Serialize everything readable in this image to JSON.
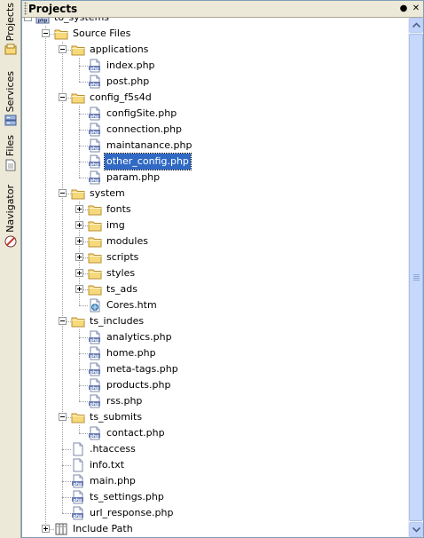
{
  "side_tabs": [
    {
      "label": "Projects",
      "icon": "projects-icon"
    },
    {
      "label": "Services",
      "icon": "services-icon"
    },
    {
      "label": "Files",
      "icon": "files-icon"
    },
    {
      "label": "Navigator",
      "icon": "navigator-icon"
    }
  ],
  "panel": {
    "title": "Projects",
    "pin_label": "●",
    "close_label": "✕"
  },
  "tree": [
    {
      "label": "to_systems",
      "depth": 0,
      "type": "project",
      "toggle": "minus"
    },
    {
      "label": "Source Files",
      "depth": 1,
      "type": "folder",
      "toggle": "minus"
    },
    {
      "label": "applications",
      "depth": 2,
      "type": "folder",
      "toggle": "minus"
    },
    {
      "label": "index.php",
      "depth": 3,
      "type": "php"
    },
    {
      "label": "post.php",
      "depth": 3,
      "type": "php"
    },
    {
      "label": "config_f5s4d",
      "depth": 2,
      "type": "folder",
      "toggle": "minus"
    },
    {
      "label": "configSite.php",
      "depth": 3,
      "type": "php"
    },
    {
      "label": "connection.php",
      "depth": 3,
      "type": "php"
    },
    {
      "label": "maintanance.php",
      "depth": 3,
      "type": "php"
    },
    {
      "label": "other_config.php",
      "depth": 3,
      "type": "php",
      "selected": true
    },
    {
      "label": "param.php",
      "depth": 3,
      "type": "php"
    },
    {
      "label": "system",
      "depth": 2,
      "type": "folder",
      "toggle": "minus"
    },
    {
      "label": "fonts",
      "depth": 3,
      "type": "folder",
      "toggle": "plus"
    },
    {
      "label": "img",
      "depth": 3,
      "type": "folder",
      "toggle": "plus"
    },
    {
      "label": "modules",
      "depth": 3,
      "type": "folder",
      "toggle": "plus"
    },
    {
      "label": "scripts",
      "depth": 3,
      "type": "folder",
      "toggle": "plus"
    },
    {
      "label": "styles",
      "depth": 3,
      "type": "folder",
      "toggle": "plus"
    },
    {
      "label": "ts_ads",
      "depth": 3,
      "type": "folder",
      "toggle": "plus"
    },
    {
      "label": "Cores.htm",
      "depth": 3,
      "type": "htm"
    },
    {
      "label": "ts_includes",
      "depth": 2,
      "type": "folder",
      "toggle": "minus"
    },
    {
      "label": "analytics.php",
      "depth": 3,
      "type": "php"
    },
    {
      "label": "home.php",
      "depth": 3,
      "type": "php"
    },
    {
      "label": "meta-tags.php",
      "depth": 3,
      "type": "php"
    },
    {
      "label": "products.php",
      "depth": 3,
      "type": "php"
    },
    {
      "label": "rss.php",
      "depth": 3,
      "type": "php"
    },
    {
      "label": "ts_submits",
      "depth": 2,
      "type": "folder",
      "toggle": "minus"
    },
    {
      "label": "contact.php",
      "depth": 3,
      "type": "php"
    },
    {
      "label": ".htaccess",
      "depth": 2,
      "type": "file"
    },
    {
      "label": "info.txt",
      "depth": 2,
      "type": "file"
    },
    {
      "label": "main.php",
      "depth": 2,
      "type": "php"
    },
    {
      "label": "ts_settings.php",
      "depth": 2,
      "type": "php"
    },
    {
      "label": "url_response.php",
      "depth": 2,
      "type": "php"
    },
    {
      "label": "Include Path",
      "depth": 1,
      "type": "library",
      "toggle": "plus"
    }
  ],
  "colors": {
    "selection": "#316ac5",
    "folder": "#f7d97c",
    "php_badge": "#6b7fb8",
    "scrollbar": "#c6d8fc"
  }
}
